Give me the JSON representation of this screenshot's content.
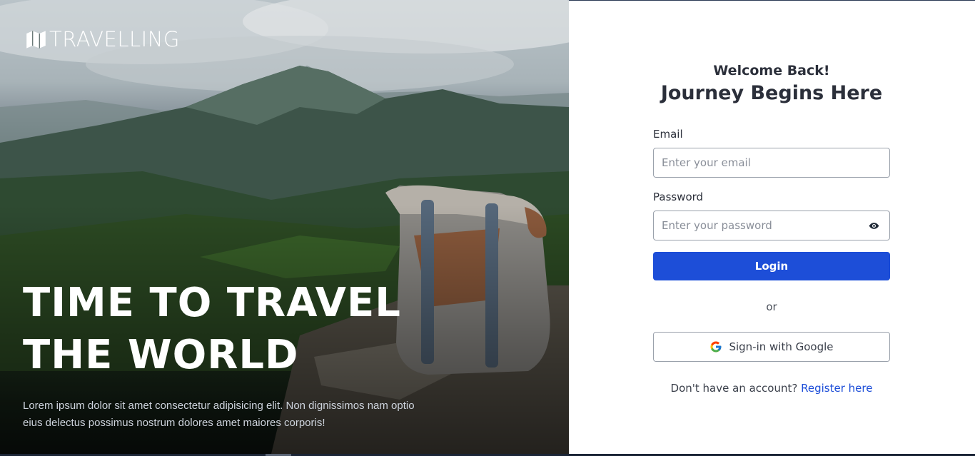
{
  "brand": {
    "name": "TRAVELLING",
    "icon": "map-icon"
  },
  "hero": {
    "title_line1": "TIME TO TRAVEL",
    "title_line2": "THE WORLD",
    "description": "Lorem ipsum dolor sit amet consectetur adipisicing elit. Non dignissimos nam optio eius delectus possimus nostrum dolores amet maiores corporis!"
  },
  "login": {
    "welcome": "Welcome Back!",
    "headline": "Journey Begins Here",
    "email_label": "Email",
    "email_placeholder": "Enter your email",
    "email_value": "",
    "password_label": "Password",
    "password_placeholder": "Enter your password",
    "password_value": "",
    "password_toggle_icon": "eye-icon",
    "login_button": "Login",
    "divider": "or",
    "google_button": "Sign-in with Google",
    "google_icon": "google-icon",
    "register_prompt": "Don't have an account?",
    "register_link": "Register here"
  },
  "colors": {
    "primary": "#1d4ed8",
    "text_dark": "#2b2f3a",
    "panel_bg": "#ffffff"
  }
}
